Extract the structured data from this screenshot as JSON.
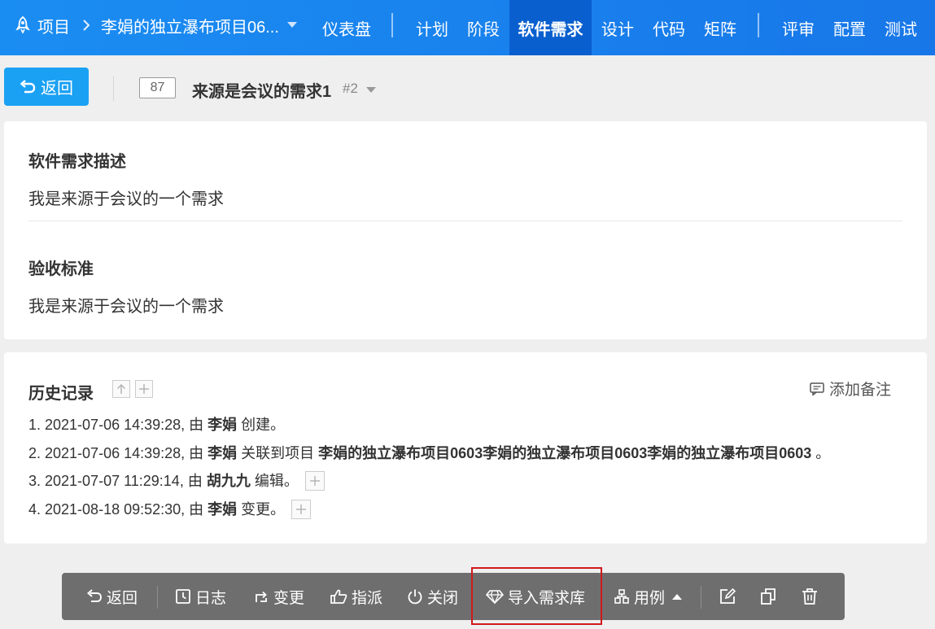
{
  "nav": {
    "breadcrumb_root": "项目",
    "project_name": "李娟的独立瀑布项目06...",
    "items": [
      {
        "label": "仪表盘"
      },
      {
        "label": "计划"
      },
      {
        "label": "阶段"
      },
      {
        "label": "软件需求"
      },
      {
        "label": "设计"
      },
      {
        "label": "代码"
      },
      {
        "label": "矩阵"
      },
      {
        "label": "评审"
      },
      {
        "label": "配置"
      },
      {
        "label": "测试"
      }
    ],
    "active": "软件需求",
    "colors": {
      "bar": "#1a8df2",
      "active": "#0a5fcf"
    }
  },
  "header": {
    "back_label": "返回",
    "id": "87",
    "title": "来源是会议的需求1",
    "version": "#2"
  },
  "detail": {
    "desc_title": "软件需求描述",
    "desc_text": "我是来源于会议的一个需求",
    "accept_title": "验收标准",
    "accept_text": "我是来源于会议的一个需求"
  },
  "history": {
    "title": "历史记录",
    "add_note": "添加备注",
    "entries": [
      {
        "prefix": "1. 2021-07-06 14:39:28, 由",
        "user": "李娟",
        "action": "创建。",
        "target": "",
        "suffix": ""
      },
      {
        "prefix": "2. 2021-07-06 14:39:28, 由",
        "user": "李娟",
        "action": "关联到项目",
        "target": "李娟的独立瀑布项目0603李娟的独立瀑布项目0603李娟的独立瀑布项目0603",
        "suffix": "。"
      },
      {
        "prefix": "3. 2021-07-07 11:29:14, 由",
        "user": "胡九九",
        "action": "编辑。",
        "target": "",
        "suffix": ""
      },
      {
        "prefix": "4. 2021-08-18 09:52:30, 由",
        "user": "李娟",
        "action": "变更。",
        "target": "",
        "suffix": ""
      }
    ]
  },
  "toolbar": {
    "back": "返回",
    "log": "日志",
    "change": "变更",
    "assign": "指派",
    "close": "关闭",
    "import": "导入需求库",
    "cases": "用例",
    "accent_highlight": "#d0191d"
  }
}
